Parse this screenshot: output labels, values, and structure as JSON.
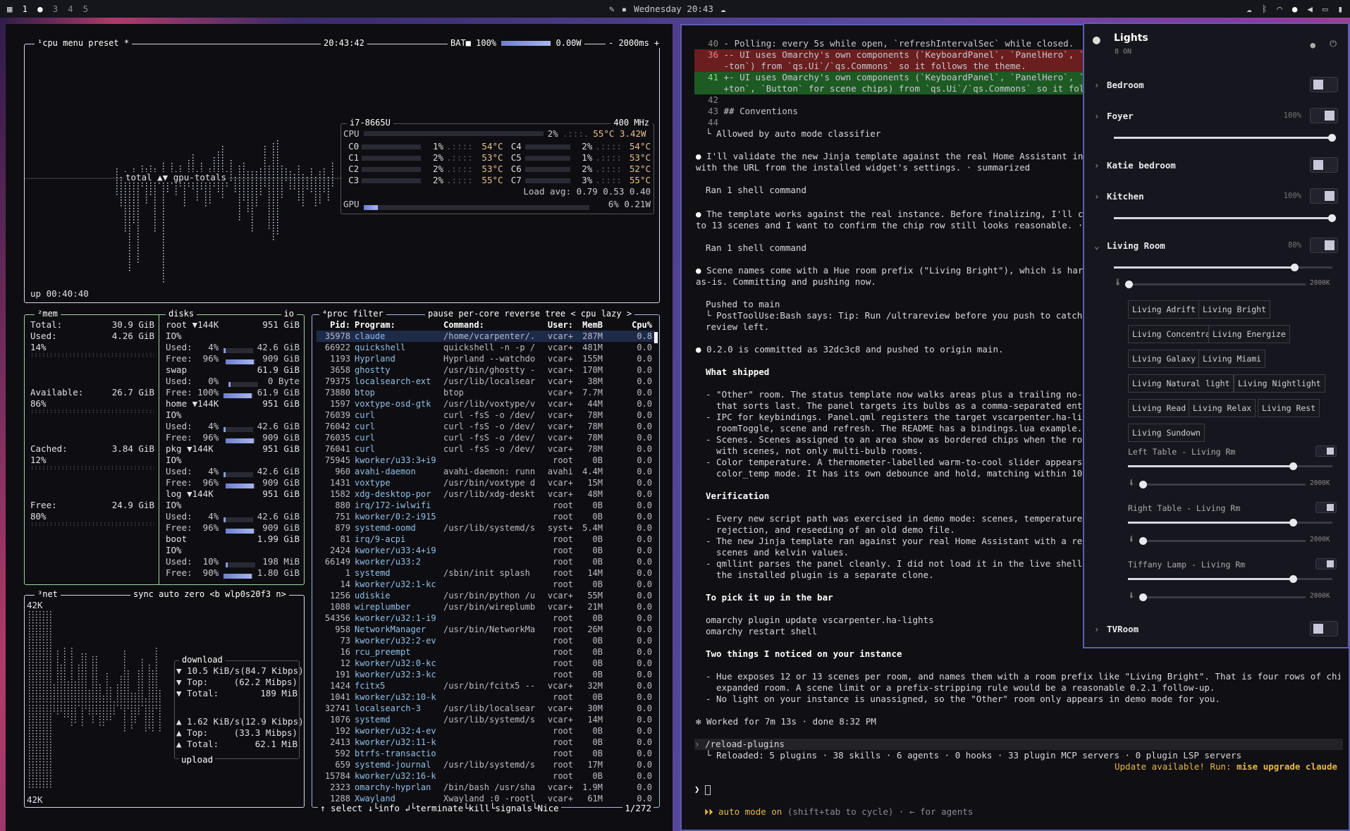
{
  "topbar": {
    "workspaces": [
      "1",
      "2",
      "3",
      "4",
      "5"
    ],
    "clock": "Wednesday 20:43"
  },
  "btop": {
    "cpu": {
      "tag": "¹cpu",
      "menu": "menu",
      "preset": "preset *",
      "time": "20:43:42",
      "bat": "BAT■ 100%",
      "power": "0.00W",
      "interval": "- 2000ms +",
      "graph_label": "total ▲▼ gpu-totals",
      "uptime": "up 00:40:40",
      "model": "i7-8665U",
      "freq": "400 MHz",
      "cpu_line": "CPU",
      "cpu_pct": "2%",
      "cpu_temp": "55°C 3.42W",
      "cores": [
        [
          "C0",
          "1%",
          "54°C",
          "C4",
          "2%",
          "54°C"
        ],
        [
          "C1",
          "2%",
          "53°C",
          "C5",
          "1%",
          "53°C"
        ],
        [
          "C2",
          "2%",
          "53°C",
          "C6",
          "2%",
          "52°C"
        ],
        [
          "C3",
          "2%",
          "55°C",
          "C7",
          "3%",
          "55°C"
        ]
      ],
      "load": "Load avg: 0.79 0.53 0.40",
      "gpu_line": "GPU",
      "gpu_val": "6% 0.21W"
    },
    "mem": {
      "tag": "²mem",
      "rows": [
        [
          "Total:",
          "30.9 GiB"
        ],
        [
          "Used:",
          "4.26 GiB"
        ],
        [
          "14%",
          ""
        ],
        [
          "Available:",
          "26.7 GiB"
        ],
        [
          "86%",
          ""
        ],
        [
          "Cached:",
          "3.84 GiB"
        ],
        [
          "12%",
          ""
        ],
        [
          "Free:",
          "24.9 GiB"
        ],
        [
          "80%",
          ""
        ]
      ]
    },
    "disks": {
      "tag": "disks",
      "io": "io",
      "entries": [
        {
          "name": "root",
          "hdr": "▼144K",
          "size": "951 GiB",
          "io": "IO%",
          "used": "4%",
          "usedv": "42.6 GiB",
          "free": "96%",
          "freev": "909 GiB"
        },
        {
          "name": "swap",
          "hdr": "",
          "size": "61.9 GiB",
          "io": "",
          "used": "0%",
          "usedv": "0 Byte",
          "free": "100%",
          "freev": "61.9 GiB"
        },
        {
          "name": "home",
          "hdr": "▼144K",
          "size": "951 GiB",
          "io": "IO%",
          "used": "4%",
          "usedv": "42.6 GiB",
          "free": "96%",
          "freev": "909 GiB"
        },
        {
          "name": "pkg",
          "hdr": "▼144K",
          "size": "951 GiB",
          "io": "IO%",
          "used": "4%",
          "usedv": "42.6 GiB",
          "free": "96%",
          "freev": "909 GiB"
        },
        {
          "name": "log",
          "hdr": "▼144K",
          "size": "951 GiB",
          "io": "IO%",
          "used": "4%",
          "usedv": "42.6 GiB",
          "free": "96%",
          "freev": "909 GiB"
        },
        {
          "name": "boot",
          "hdr": "",
          "size": "1.99 GiB",
          "io": "IO%",
          "used": "10%",
          "usedv": "198 MiB",
          "free": "90%",
          "freev": "1.80 GiB"
        }
      ]
    },
    "net": {
      "tag": "³net",
      "sync": "sync",
      "auto": "auto",
      "zero": "zero",
      "iface": "<b wlp0s20f3 n>",
      "scale": "42K",
      "scale_bottom": "42K",
      "download": "download",
      "dl": [
        [
          "▼ 10.5 KiB/s",
          "(84.7 Kibps)"
        ],
        [
          "▼ Top:",
          "(62.2 Mibps)"
        ],
        [
          "▼ Total:",
          "189 MiB"
        ]
      ],
      "ul": [
        [
          "▲ 1.62 KiB/s",
          "(12.9 Kibps)"
        ],
        [
          "▲ Top:",
          "(33.3 Mibps)"
        ],
        [
          "▲ Total:",
          "62.1 MiB"
        ]
      ],
      "upload": "upload"
    },
    "proc": {
      "tag": "⁴proc",
      "filter": "filter",
      "opts": [
        "pause",
        "per-core",
        "reverse",
        "tree",
        "< cpu lazy >"
      ],
      "header": [
        "Pid:",
        "Program:",
        "Command:",
        "User:",
        "MemB",
        "Cpu%"
      ],
      "rows": [
        [
          "35978",
          "claude",
          "/home/vcarpenter/.",
          "vcar+",
          "287M",
          "0.8"
        ],
        [
          "66922",
          "quickshell",
          "quickshell -n -p /",
          "vcar+",
          "481M",
          "0.0"
        ],
        [
          "1193",
          "Hyprland",
          "Hyprland --watchdo",
          "vcar+",
          "155M",
          "0.0"
        ],
        [
          "3658",
          "ghostty",
          "/usr/bin/ghostty -",
          "vcar+",
          "170M",
          "0.0"
        ],
        [
          "79375",
          "localsearch-ext",
          "/usr/lib/localsear",
          "vcar+",
          "38M",
          "0.0"
        ],
        [
          "73880",
          "btop",
          "btop",
          "vcar+",
          "7.7M",
          "0.0"
        ],
        [
          "1597",
          "voxtype-osd-gtk",
          "/usr/lib/voxtype/v",
          "vcar+",
          "44M",
          "0.0"
        ],
        [
          "76039",
          "curl",
          "curl -fsS -o /dev/",
          "vcar+",
          "78M",
          "0.0"
        ],
        [
          "76042",
          "curl",
          "curl -fsS -o /dev/",
          "vcar+",
          "78M",
          "0.0"
        ],
        [
          "76035",
          "curl",
          "curl -fsS -o /dev/",
          "vcar+",
          "78M",
          "0.0"
        ],
        [
          "76041",
          "curl",
          "curl -fsS -o /dev/",
          "vcar+",
          "78M",
          "0.0"
        ],
        [
          "75945",
          "kworker/u33:3+i9",
          "",
          "root",
          "0B",
          "0.0"
        ],
        [
          "960",
          "avahi-daemon",
          "avahi-daemon: runn",
          "avahi",
          "4.4M",
          "0.0"
        ],
        [
          "1431",
          "voxtype",
          "/usr/bin/voxtype d",
          "vcar+",
          "15M",
          "0.0"
        ],
        [
          "1582",
          "xdg-desktop-por",
          "/usr/lib/xdg-deskt",
          "vcar+",
          "48M",
          "0.0"
        ],
        [
          "880",
          "irq/172-iwlwifi",
          "",
          "root",
          "0B",
          "0.0"
        ],
        [
          "751",
          "kworker/0:2-i915",
          "",
          "root",
          "0B",
          "0.0"
        ],
        [
          "879",
          "systemd-oomd",
          "/usr/lib/systemd/s",
          "syst+",
          "5.4M",
          "0.0"
        ],
        [
          "81",
          "irq/9-acpi",
          "",
          "root",
          "0B",
          "0.0"
        ],
        [
          "2424",
          "kworker/u33:4+i9",
          "",
          "root",
          "0B",
          "0.0"
        ],
        [
          "66149",
          "kworker/u33:2",
          "",
          "root",
          "0B",
          "0.0"
        ],
        [
          "1",
          "systemd",
          "/sbin/init splash",
          "root",
          "14M",
          "0.0"
        ],
        [
          "14",
          "kworker/u32:1-kc",
          "",
          "root",
          "0B",
          "0.0"
        ],
        [
          "1256",
          "udiskie",
          "/usr/bin/python /u",
          "vcar+",
          "55M",
          "0.0"
        ],
        [
          "1088",
          "wireplumber",
          "/usr/bin/wireplumb",
          "vcar+",
          "21M",
          "0.0"
        ],
        [
          "54356",
          "kworker/u32:1-i9",
          "",
          "root",
          "0B",
          "0.0"
        ],
        [
          "958",
          "NetworkManager",
          "/usr/bin/NetworkMa",
          "root",
          "26M",
          "0.0"
        ],
        [
          "73",
          "kworker/u32:2-ev",
          "",
          "root",
          "0B",
          "0.0"
        ],
        [
          "16",
          "rcu_preempt",
          "",
          "root",
          "0B",
          "0.0"
        ],
        [
          "12",
          "kworker/u32:0-kc",
          "",
          "root",
          "0B",
          "0.0"
        ],
        [
          "191",
          "kworker/u32:3-kc",
          "",
          "root",
          "0B",
          "0.0"
        ],
        [
          "1424",
          "fcitx5",
          "/usr/bin/fcitx5 --",
          "vcar+",
          "32M",
          "0.0"
        ],
        [
          "1041",
          "kworker/u32:10-k",
          "",
          "root",
          "0B",
          "0.0"
        ],
        [
          "32741",
          "localsearch-3",
          "/usr/lib/localsear",
          "vcar+",
          "30M",
          "0.0"
        ],
        [
          "1076",
          "systemd",
          "/usr/lib/systemd/s",
          "vcar+",
          "14M",
          "0.0"
        ],
        [
          "192",
          "kworker/u32:4-ev",
          "",
          "root",
          "0B",
          "0.0"
        ],
        [
          "2413",
          "kworker/u32:11-k",
          "",
          "root",
          "0B",
          "0.0"
        ],
        [
          "592",
          "btrfs-transactio",
          "",
          "root",
          "0B",
          "0.0"
        ],
        [
          "659",
          "systemd-journal",
          "/usr/lib/systemd/s",
          "root",
          "17M",
          "0.0"
        ],
        [
          "15784",
          "kworker/u32:16-k",
          "",
          "root",
          "0B",
          "0.0"
        ],
        [
          "2323",
          "omarchy-hyprlan",
          "/bin/bash /usr/sha",
          "vcar+",
          "1.9M",
          "0.0"
        ],
        [
          "1288",
          "Xwayland",
          "Xwayland :0 -rootl",
          "vcar+",
          "61M",
          "0.0"
        ]
      ],
      "footer": "↑ select ↓└info ↲└terminate└kill└signals└Nice",
      "count": "1/272"
    }
  },
  "claude": {
    "diff": [
      {
        "n": "40",
        "t": " - Polling: every 5s while open, `refreshIntervalSec` while closed.",
        "k": "ctx"
      },
      {
        "n": "36",
        "t": " -- UI uses Omarchy's own components (`KeyboardPanel`, `PanelHero`, `To",
        "k": "del"
      },
      {
        "n": "",
        "t": " -ton`) from `qs.Ui`/`qs.Commons` so it follows the theme.",
        "k": "del"
      },
      {
        "n": "41",
        "t": " +- UI uses Omarchy's own components (`KeyboardPanel`, `PanelHero`, `To",
        "k": "add"
      },
      {
        "n": "",
        "t": " +ton`, `Button` for scene chips) from `qs.Ui`/`qs.Commons` so it follo",
        "k": "add"
      },
      {
        "n": "42",
        "t": "",
        "k": "ctx"
      },
      {
        "n": "43",
        "t": " ## Conventions",
        "k": "ctx"
      },
      {
        "n": "44",
        "t": "",
        "k": "ctx"
      }
    ],
    "allowed": "Allowed by auto mode classifier",
    "msg1": "I'll validate the new Jinja template against the real Home Assistant instance\nwith the URL from the installed widget's settings. · summarized",
    "ran1": "Ran 1 shell command",
    "msg2": "The template works against the real instance. Before finalizing, I'll check t\nto 13 scenes and I want to confirm the chip row still looks reasonable. · su",
    "ran2": "Ran 1 shell command",
    "msg3": "Scene names come with a Hue room prefix (\"Living Bright\"), which is harmless\nas-is. Committing and pushing now.",
    "pushed": "Pushed to main",
    "hook": "PostToolUse:Bash says: Tip: Run /ultrareview before you push to catch bug\nreview left.",
    "msg4": "0.2.0 is committed as 32dc3c8 and pushed to origin main.",
    "shipped_h": "What shipped",
    "shipped": "- \"Other\" room. The status template now walks areas plus a trailing no-area p\n  that sorts last. The panel targets its bulbs as a comma-separated entity l\n- IPC for keybindings. Panel.qml registers the target vscarpenter.ha-lights w\n  roomToggle, scene and refresh. The README has a bindings.lua example.\n- Scenes. Scenes assigned to an area show as bordered chips when the room is \n  with scenes, not only multi-bulb rooms.\n- Color temperature. A thermometer-labelled warm-to-cool slider appears under\n  color_temp mode. It has its own debounce and hold, matching within 100K.",
    "verif_h": "Verification",
    "verif": "- Every new script path was exercised in demo mode: scenes, temperature on an\n  rejection, and reseeding of an old demo file.\n- The new Jinja template ran against your real Home Assistant with a read-onl\n  scenes and kelvin values.\n- qmllint parses the panel cleanly. I did not load it in the live shell, sinc\n  the installed plugin is a separate clone.",
    "pick_h": "To pick it up in the bar",
    "pick": "omarchy plugin update vscarpenter.ha-lights\nomarchy restart shell",
    "two_h": "Two things I noticed on your instance",
    "two": "- Hue exposes 12 or 13 scenes per room, and names them with a room prefix like \"Living Bright\". That is four rows of chips per\n  expanded room. A scene limit or a prefix-stripping rule would be a reasonable 0.2.1 follow-up.\n- No light on your instance is unassigned, so the \"Other\" room only appears in demo mode for you.",
    "worked": "✻ Worked for 7m 13s · done 8:32 PM",
    "cmd": "/reload-plugins",
    "reloaded": "Reloaded: 5 plugins · 38 skills · 6 agents · 0 hooks · 33 plugin MCP servers · 0 plugin LSP servers",
    "update": "Update available! Run: ",
    "update_cmd": "mise upgrade claude",
    "prompt": "❯",
    "mode": "⏵⏵ auto mode on",
    "mode_hint": " (shift+tab to cycle) · ← for agents"
  },
  "lights": {
    "title": "Lights",
    "subtitle": "8 ON",
    "rooms": [
      {
        "name": "Bedroom",
        "pct": "",
        "on": false
      },
      {
        "name": "Foyer",
        "pct": "100%",
        "on": true,
        "level": 100
      },
      {
        "name": "Katie bedroom",
        "pct": "",
        "on": false
      },
      {
        "name": "Kitchen",
        "pct": "100%",
        "on": true,
        "level": 100
      },
      {
        "name": "Living Room",
        "pct": "80%",
        "on": true,
        "level": 80
      }
    ],
    "temp_max": "2000K",
    "scenes": [
      "Living Adrift",
      "Living Bright",
      "Living Concentrate",
      "Living Energize",
      "Living Galaxy",
      "Living Miami",
      "Living Natural light",
      "Living Nightlight",
      "Living Read",
      "Living Relax",
      "Living Rest",
      "Living Sundown"
    ],
    "bulbs": [
      {
        "name": "Left Table - Living Rm",
        "level": 80
      },
      {
        "name": "Right Table - Living Rm",
        "level": 80
      },
      {
        "name": "Tiffany Lamp - Living Rm",
        "level": 80
      }
    ],
    "tvroom": "TVRoom"
  }
}
